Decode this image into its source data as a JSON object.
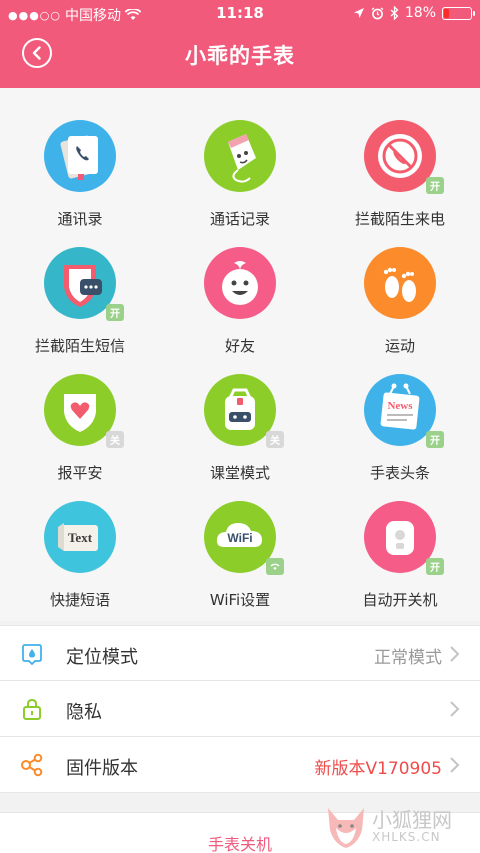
{
  "status_bar": {
    "signal": "●●●○○",
    "carrier": "中国移动",
    "time": "11:18",
    "battery": "18%",
    "battery_level": 0.18
  },
  "nav": {
    "title": "小乖的手表",
    "back_icon": "back-arrow-circle-icon"
  },
  "features": [
    {
      "label": "通讯录",
      "icon": "contacts-icon",
      "color": "#3fb2ea",
      "badge": ""
    },
    {
      "label": "通话记录",
      "icon": "call-log-icon",
      "color": "#8ccd2a",
      "badge": ""
    },
    {
      "label": "拦截陌生来电",
      "icon": "block-call-icon",
      "color": "#f35c6c",
      "badge": "开"
    },
    {
      "label": "拦截陌生短信",
      "icon": "block-sms-icon",
      "color": "#35b6c9",
      "badge": "开"
    },
    {
      "label": "好友",
      "icon": "friends-icon",
      "color": "#f65c88",
      "badge": ""
    },
    {
      "label": "运动",
      "icon": "sport-icon",
      "color": "#fb8b2b",
      "badge": ""
    },
    {
      "label": "报平安",
      "icon": "safe-report-icon",
      "color": "#8ccd2a",
      "badge": "关"
    },
    {
      "label": "课堂模式",
      "icon": "class-mode-icon",
      "color": "#8ccd2a",
      "badge": "关"
    },
    {
      "label": "手表头条",
      "icon": "news-icon",
      "color": "#3fb2ea",
      "badge": "开"
    },
    {
      "label": "快捷短语",
      "icon": "quick-phrase-icon",
      "color": "#3fc4dd",
      "badge": "",
      "icon_text": "Text"
    },
    {
      "label": "WiFi设置",
      "icon": "wifi-settings-icon",
      "color": "#8ccd2a",
      "badge": "",
      "icon_text": "WiFi"
    },
    {
      "label": "自动开关机",
      "icon": "auto-power-icon",
      "color": "#f65c88",
      "badge": "开"
    }
  ],
  "news_icon_text": "News",
  "settings": [
    {
      "label": "定位模式",
      "value": "正常模式",
      "value_color": "#999999",
      "icon": "location-mode-icon"
    },
    {
      "label": "隐私",
      "value": "",
      "value_color": "#999999",
      "icon": "lock-icon"
    },
    {
      "label": "固件版本",
      "value": "新版本V170905",
      "value_color": "#f04b4b",
      "icon": "firmware-icon"
    }
  ],
  "power_off": "手表关机",
  "watermark": {
    "line1": "小狐狸网",
    "line2": "XHLKS.CN"
  },
  "colors": {
    "accent": "#f25a7c"
  }
}
